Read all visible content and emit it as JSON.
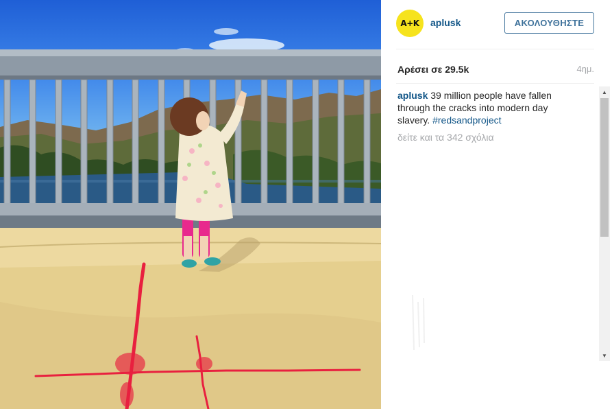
{
  "post": {
    "photo_subject": "toddler-pointing-at-hills-over-bridge-railing",
    "author": {
      "username": "aplusk",
      "avatar_text": "A+K",
      "avatar_color": "#f6e31d"
    },
    "follow_label": "ΑΚΟΛΟΥΘΗΣΤΕ",
    "likes_text": "Αρέσει σε 29.5k",
    "time_ago": "4ημ.",
    "caption": {
      "username": "aplusk",
      "text": " 39 million people have fallen through the cracks into modern day slavery. ",
      "hashtag": "#redsandproject"
    },
    "view_comments": "δείτε και τα 342 σχόλια"
  },
  "colors": {
    "link_blue": "#125688",
    "follow_border": "#3f729b",
    "muted_text": "#a5a7aa",
    "red_sand": "#e8203f"
  },
  "icons": {
    "scroll_up": "triangle-up-icon",
    "scroll_down": "triangle-down-icon"
  }
}
